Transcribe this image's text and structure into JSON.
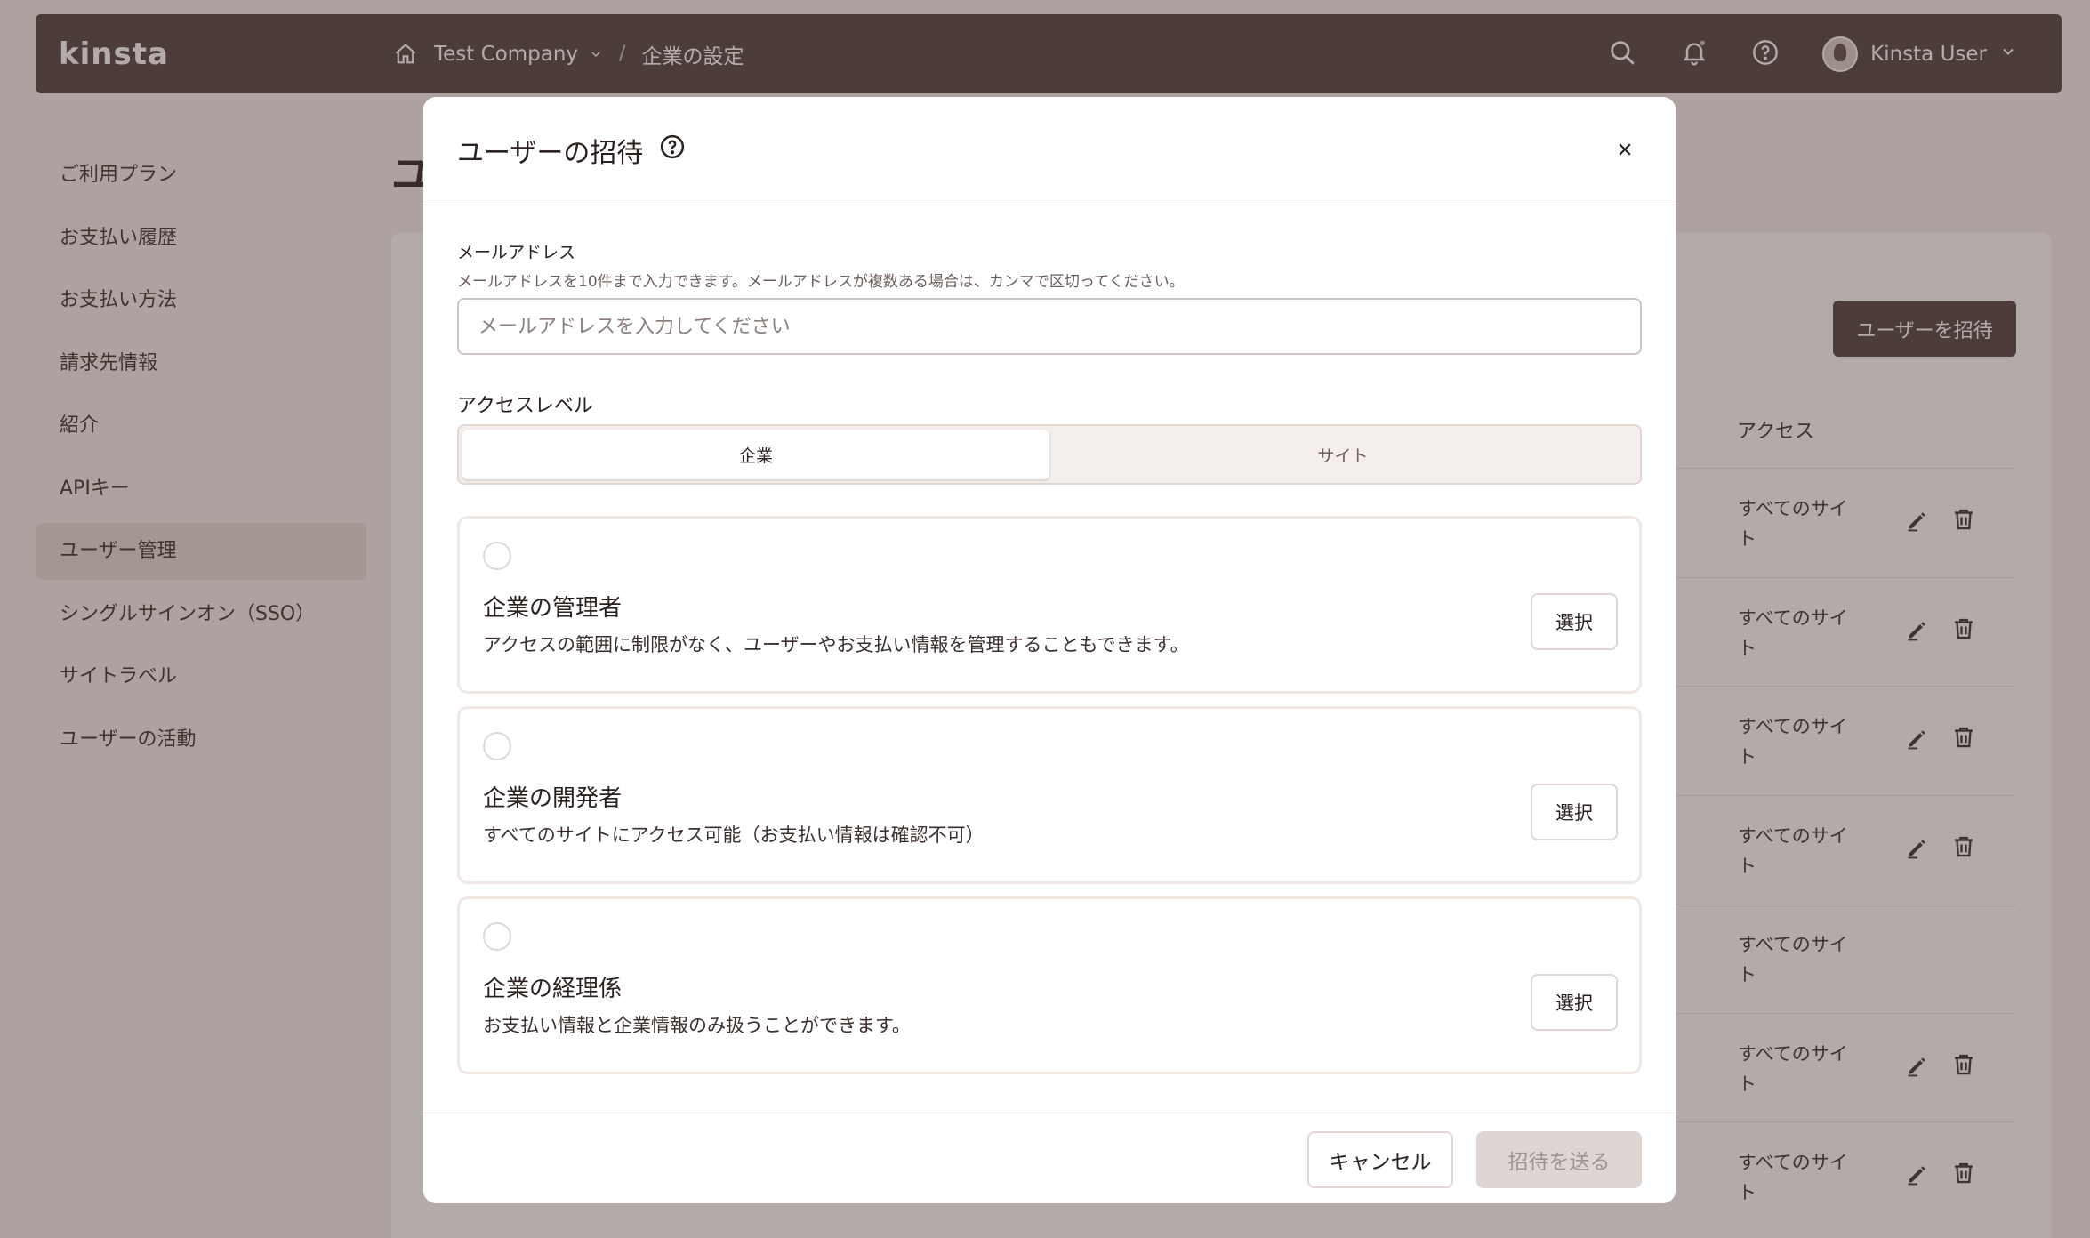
{
  "topbar": {
    "logo": "kinsta",
    "company": "Test Company",
    "page": "企業の設定",
    "user_name": "Kinsta User",
    "icons": [
      "home-icon",
      "search-icon",
      "bell-icon",
      "help-icon",
      "avatar",
      "chevron-down-icon"
    ]
  },
  "sidebar": {
    "items": [
      {
        "label": "ご利用プラン"
      },
      {
        "label": "お支払い履歴"
      },
      {
        "label": "お支払い方法"
      },
      {
        "label": "請求先情報"
      },
      {
        "label": "紹介"
      },
      {
        "label": "APIキー"
      },
      {
        "label": "ユーザー管理"
      },
      {
        "label": "シングルサインオン（SSO）"
      },
      {
        "label": "サイトラベル"
      },
      {
        "label": "ユーザーの活動"
      }
    ],
    "active_index": 6
  },
  "background": {
    "page_title": "ユ",
    "invite_button": "ユーザーを招待",
    "access_header": "アクセス",
    "rows": [
      {
        "access": "すべてのサイト"
      },
      {
        "access": "すべてのサイト"
      },
      {
        "access": "すべてのサイト"
      },
      {
        "access": "すべてのサイト"
      },
      {
        "access": "すべてのサイト"
      },
      {
        "access": "すべてのサイト"
      },
      {
        "access": "すべてのサイト"
      }
    ]
  },
  "modal": {
    "title": "ユーザーの招待",
    "email": {
      "label": "メールアドレス",
      "hint": "メールアドレスを10件まで入力できます。メールアドレスが複数ある場合は、カンマで区切ってください。",
      "placeholder": "メールアドレスを入力してください",
      "value": ""
    },
    "access": {
      "label": "アクセスレベル",
      "options": [
        "企業",
        "サイト"
      ],
      "selected": "企業"
    },
    "roles": [
      {
        "name": "企業の管理者",
        "desc": "アクセスの範囲に制限がなく、ユーザーやお支払い情報を管理することもできます。",
        "button": "選択",
        "checked": false
      },
      {
        "name": "企業の開発者",
        "desc": "すべてのサイトにアクセス可能（お支払い情報は確認不可）",
        "button": "選択",
        "checked": false
      },
      {
        "name": "企業の経理係",
        "desc": "お支払い情報と企業情報のみ扱うことができます。",
        "button": "選択",
        "checked": false
      }
    ],
    "cancel_label": "キャンセル",
    "send_label": "招待を送る"
  }
}
